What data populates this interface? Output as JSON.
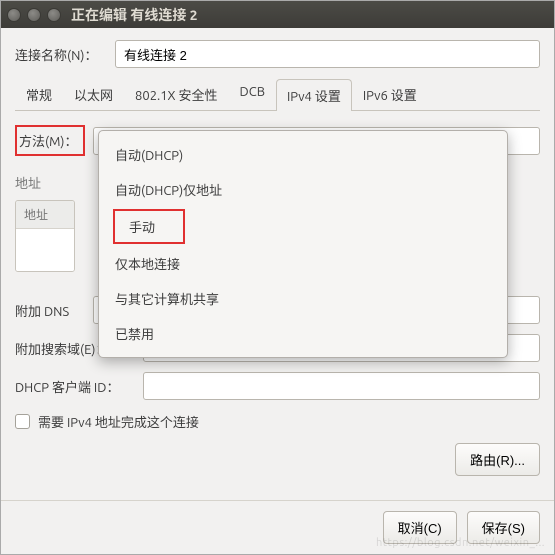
{
  "titlebar": {
    "title": "正在编辑 有线连接 2"
  },
  "connection_name": {
    "label": "连接名称(N)：",
    "value": "有线连接 2"
  },
  "tabs": [
    {
      "label": "常规",
      "active": false
    },
    {
      "label": "以太网",
      "active": false
    },
    {
      "label": "802.1X 安全性",
      "active": false
    },
    {
      "label": "DCB",
      "active": false
    },
    {
      "label": "IPv4 设置",
      "active": true
    },
    {
      "label": "IPv6 设置",
      "active": false
    }
  ],
  "method": {
    "label": "方法(M)：",
    "selected": "自动(DHCP)",
    "options": [
      "自动(DHCP)",
      "自动(DHCP)仅地址",
      "手动",
      "仅本地连接",
      "与其它计算机共享",
      "已禁用"
    ],
    "highlighted_option_index": 2
  },
  "address": {
    "section_title": "地址",
    "column_header": "地址"
  },
  "dns": {
    "label": "附加 DNS",
    "value": ""
  },
  "search_domain": {
    "label": "附加搜索域(E)：",
    "value": ""
  },
  "dhcp_client": {
    "label": "DHCP 客户端 ID：",
    "value": ""
  },
  "require_ipv4": {
    "label": "需要 IPv4 地址完成这个连接",
    "checked": false
  },
  "routes_button": "路由(R)...",
  "footer": {
    "cancel": "取消(C)",
    "save": "保存(S)"
  },
  "colors": {
    "highlight_red": "#e03030",
    "bg": "#f2f1f0"
  },
  "watermark": "https://blog.csdn.net/weixin_..."
}
